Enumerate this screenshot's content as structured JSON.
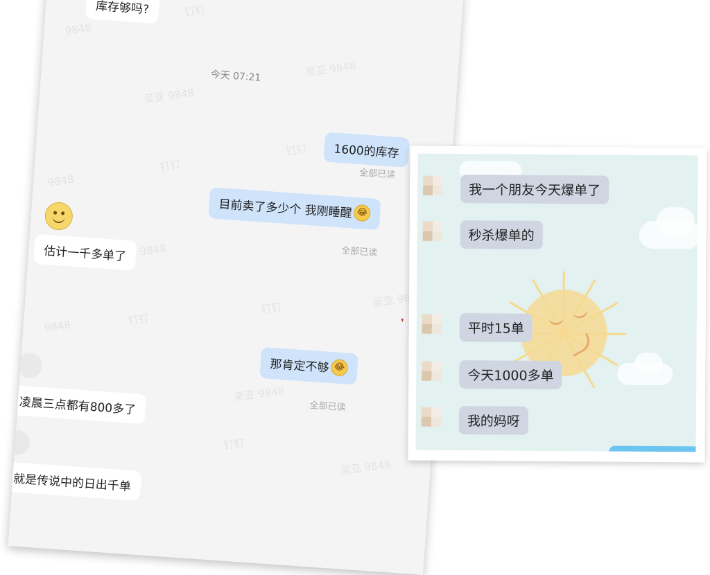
{
  "left_chat": {
    "timestamp": "今天 07:21",
    "watermarks": [
      "钉钉",
      "吴亚 9848",
      "9848"
    ],
    "messages": [
      {
        "side": "in",
        "text": "库存够吗?"
      },
      {
        "side": "out",
        "text": "1600的库存",
        "status": "全部已读"
      },
      {
        "side": "out",
        "text": "目前卖了多少个 我刚睡醒",
        "emoji": "laughing-tears",
        "status": "全部已读"
      },
      {
        "side": "in",
        "text": "估计一千多单了"
      },
      {
        "side": "out",
        "text": "那肯定不够",
        "emoji": "laughing-tears",
        "status": "全部已读"
      },
      {
        "side": "in",
        "text": "凌晨三点都有800多了"
      },
      {
        "side": "in",
        "text": "这就是传说中的日出千单"
      }
    ]
  },
  "right_chat": {
    "messages": [
      {
        "side": "in",
        "text": "我一个朋友今天爆单了"
      },
      {
        "side": "in",
        "text": "秒杀爆单的"
      },
      {
        "side": "in",
        "text": "平时15单"
      },
      {
        "side": "in",
        "text": "今天1000多单"
      },
      {
        "side": "in",
        "text": "我的妈呀"
      }
    ],
    "background": "sun-and-clouds"
  },
  "colors": {
    "outgoing_bubble": "#cfe4fb",
    "incoming_bubble": "#ffffff",
    "right_bubble": "#cfd6e2",
    "right_background": "#e3f1f1"
  }
}
